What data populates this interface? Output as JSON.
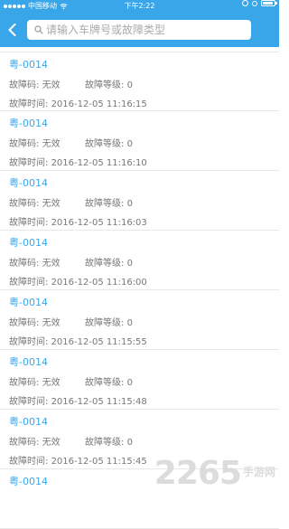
{
  "status_bar": {
    "carrier": "中国移动",
    "time": "下午2:22"
  },
  "header": {
    "search_placeholder": "请输入车牌号或故障类型"
  },
  "records": [
    {
      "plate": "粤-0014",
      "code_label": "故障码:",
      "code_value": "无效",
      "level_label": "故障等级:",
      "level_value": "0",
      "time_label": "故障时间:",
      "time_value": "2016-12-05 11:16:15"
    },
    {
      "plate": "粤-0014",
      "code_label": "故障码:",
      "code_value": "无效",
      "level_label": "故障等级:",
      "level_value": "0",
      "time_label": "故障时间:",
      "time_value": "2016-12-05 11:16:10"
    },
    {
      "plate": "粤-0014",
      "code_label": "故障码:",
      "code_value": "无效",
      "level_label": "故障等级:",
      "level_value": "0",
      "time_label": "故障时间:",
      "time_value": "2016-12-05 11:16:03"
    },
    {
      "plate": "粤-0014",
      "code_label": "故障码:",
      "code_value": "无效",
      "level_label": "故障等级:",
      "level_value": "0",
      "time_label": "故障时间:",
      "time_value": "2016-12-05 11:16:00"
    },
    {
      "plate": "粤-0014",
      "code_label": "故障码:",
      "code_value": "无效",
      "level_label": "故障等级:",
      "level_value": "0",
      "time_label": "故障时间:",
      "time_value": "2016-12-05 11:15:55"
    },
    {
      "plate": "粤-0014",
      "code_label": "故障码:",
      "code_value": "无效",
      "level_label": "故障等级:",
      "level_value": "0",
      "time_label": "故障时间:",
      "time_value": "2016-12-05 11:15:48"
    },
    {
      "plate": "粤-0014",
      "code_label": "故障码:",
      "code_value": "无效",
      "level_label": "故障等级:",
      "level_value": "0",
      "time_label": "故障时间:",
      "time_value": "2016-12-05 11:15:45"
    },
    {
      "plate": "粤-0014",
      "code_label": "",
      "code_value": "",
      "level_label": "",
      "level_value": "",
      "time_label": "",
      "time_value": ""
    }
  ],
  "watermark": {
    "number": "2265",
    "text": "手游网"
  },
  "colors": {
    "accent": "#3aa6ea",
    "text_secondary": "#777777",
    "divider": "#e8e8e8"
  }
}
